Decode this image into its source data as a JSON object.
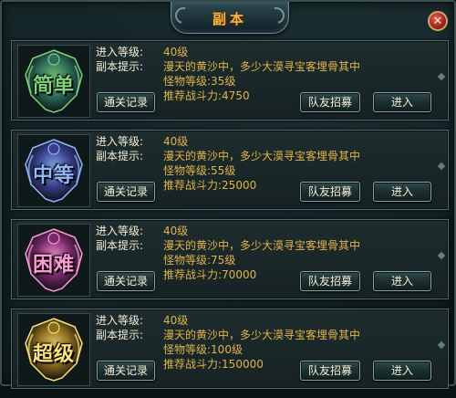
{
  "window": {
    "title": "副本",
    "close_icon": "close-icon"
  },
  "labels": {
    "level": "进入等级:",
    "hint": "副本提示:",
    "monster": "怪物等级:",
    "power": "推荐战斗力:",
    "record": "通关记录",
    "recruit": "队友招募",
    "enter": "进入"
  },
  "dungeons": [
    {
      "difficulty": "简单",
      "emblem_color": "#7fd47a",
      "emblem_bg": "#2e6b5a",
      "entry_level": "40级",
      "hint": "漫天的黄沙中，多少大漠寻宝客埋骨其中",
      "monster_level": "35级",
      "power": "4750"
    },
    {
      "difficulty": "中等",
      "emblem_color": "#8fb8ff",
      "emblem_bg": "#3a3f8c",
      "entry_level": "40级",
      "hint": "漫天的黄沙中，多少大漠寻宝客埋骨其中",
      "monster_level": "55级",
      "power": "25000"
    },
    {
      "difficulty": "困难",
      "emblem_color": "#ff9bd6",
      "emblem_bg": "#7a2a6b",
      "entry_level": "40级",
      "hint": "漫天的黄沙中，多少大漠寻宝客埋骨其中",
      "monster_level": "75级",
      "power": "70000"
    },
    {
      "difficulty": "超级",
      "emblem_color": "#ffe27a",
      "emblem_bg": "#8a6a1c",
      "entry_level": "40级",
      "hint": "漫天的黄沙中，多少大漠寻宝客埋骨其中",
      "monster_level": "100级",
      "power": "150000"
    }
  ]
}
